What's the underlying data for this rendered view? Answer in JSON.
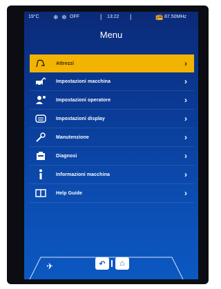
{
  "status": {
    "temperature": "19°C",
    "fan_state": "OFF",
    "time": "13:22",
    "radio_frequency": "87.50MHz"
  },
  "screen": {
    "title": "Menu"
  },
  "menu": {
    "items": [
      {
        "label": "Attrezzi",
        "icon": "tool-attachment-icon",
        "selected": true
      },
      {
        "label": "Impostazioni macchina",
        "icon": "machine-settings-icon",
        "selected": false
      },
      {
        "label": "Impostazioni operatore",
        "icon": "operator-settings-icon",
        "selected": false
      },
      {
        "label": "Impostazioni display",
        "icon": "display-settings-icon",
        "selected": false
      },
      {
        "label": "Manutenzione",
        "icon": "wrench-icon",
        "selected": false
      },
      {
        "label": "Diagnosi",
        "icon": "diagnostics-icon",
        "selected": false
      },
      {
        "label": "Informazioni macchina",
        "icon": "info-icon",
        "selected": false
      },
      {
        "label": "Help Guide",
        "icon": "book-icon",
        "selected": false
      }
    ]
  },
  "colors": {
    "selected_bg": "#f2b400",
    "screen_top": "#0b2a78",
    "screen_bottom": "#0b58c1"
  }
}
